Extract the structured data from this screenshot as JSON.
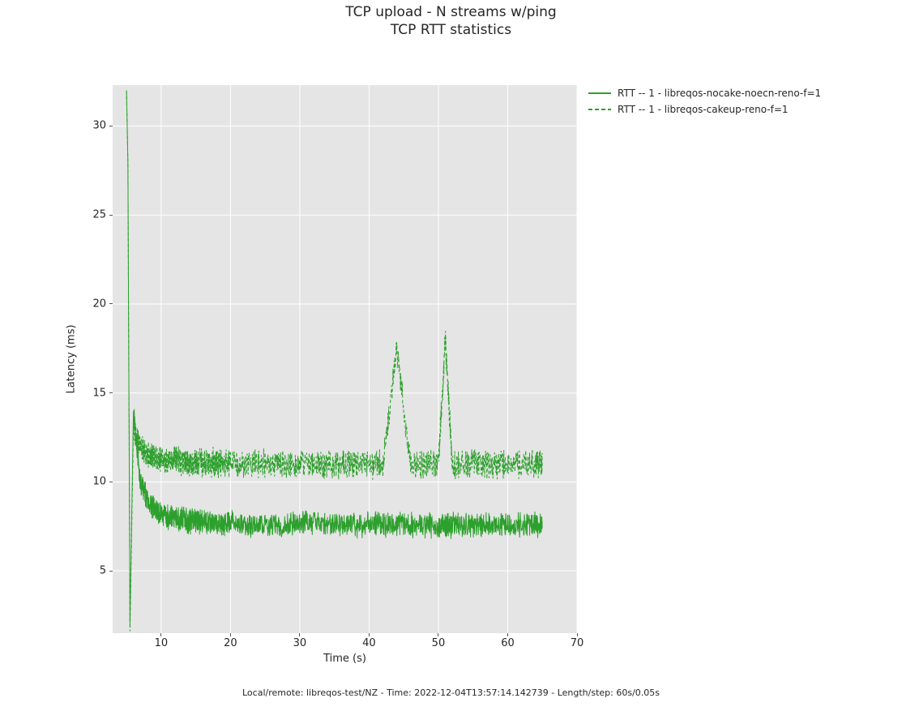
{
  "title": "TCP upload - N streams w/ping",
  "subtitle": "TCP RTT statistics",
  "xlabel": "Time (s)",
  "ylabel": "Latency (ms)",
  "footer": "Local/remote: libreqos-test/NZ - Time: 2022-12-04T13:57:14.142739 - Length/step: 60s/0.05s",
  "legend": {
    "series": [
      {
        "name": "RTT -- 1 - libreqos-nocake-noecn-reno-f=1",
        "color": "#2ca02c",
        "dash": "solid"
      },
      {
        "name": "RTT -- 1 - libreqos-cakeup-reno-f=1",
        "color": "#2ca02c",
        "dash": "dashed"
      }
    ]
  },
  "chart_data": {
    "type": "line",
    "xlim": [
      3,
      70
    ],
    "ylim": [
      1.5,
      32.3
    ],
    "x_ticks": [
      10,
      20,
      30,
      40,
      50,
      60,
      70
    ],
    "y_ticks": [
      5,
      10,
      15,
      20,
      25,
      30
    ],
    "x": [
      5,
      5.2,
      5.5,
      6,
      7,
      8,
      9,
      10,
      11,
      12,
      13,
      14,
      15,
      16,
      17,
      18,
      19,
      20,
      22,
      24,
      26,
      28,
      30,
      32,
      34,
      36,
      38,
      40,
      42,
      44,
      46,
      48,
      50,
      51,
      52,
      54,
      56,
      58,
      60,
      62,
      64,
      65
    ],
    "series": [
      {
        "name": "RTT -- 1 - libreqos-nocake-noecn-reno-f=1",
        "color": "#2ca02c",
        "dash": "solid",
        "values": [
          32,
          28,
          2,
          14,
          10,
          9,
          8.5,
          8.2,
          8.0,
          8.0,
          7.9,
          7.8,
          7.8,
          7.8,
          7.7,
          7.7,
          7.7,
          7.7,
          7.6,
          7.6,
          7.6,
          7.6,
          7.7,
          7.7,
          7.6,
          7.6,
          7.6,
          7.6,
          7.6,
          7.6,
          7.6,
          7.6,
          7.6,
          7.6,
          7.6,
          7.6,
          7.6,
          7.6,
          7.6,
          7.6,
          7.6,
          7.6
        ]
      },
      {
        "name": "RTT -- 1 - libreqos-cakeup-reno-f=1",
        "color": "#2ca02c",
        "dash": "dashed",
        "values": [
          32,
          28,
          1.6,
          13,
          12,
          11.5,
          11.4,
          11.3,
          11.2,
          11.2,
          11.2,
          11.1,
          11.1,
          11.1,
          11.1,
          11.1,
          11.1,
          11.0,
          11.0,
          11.0,
          11.0,
          11.0,
          11.0,
          11.0,
          11.0,
          11.0,
          11.0,
          11.0,
          11.0,
          17.5,
          11.0,
          11.0,
          11.0,
          18.0,
          11.0,
          11.0,
          11.0,
          11.0,
          11.0,
          11.0,
          11.0,
          11.0
        ]
      }
    ],
    "noise_amplitude": {
      "0": 1.2,
      "1": 1.4
    }
  }
}
